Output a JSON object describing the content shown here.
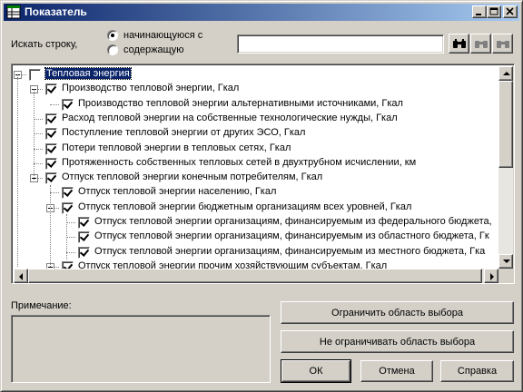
{
  "window": {
    "title": "Показатель",
    "controls": [
      "minimize-icon",
      "maximize-icon",
      "close-icon"
    ]
  },
  "search": {
    "label": "Искать строку,",
    "option_starts": "начинающуюся с",
    "option_contains": "содержащую",
    "selected": "starts",
    "value": ""
  },
  "tree": {
    "rows": [
      {
        "text": "Тепловая энергия",
        "checked": false,
        "level": 0,
        "expander": true,
        "selected": true
      },
      {
        "text": "Производство тепловой энергии,  Гкал",
        "checked": true,
        "level": 1,
        "expander": true
      },
      {
        "text": "Производство тепловой энергии альтернативными источниками, Гкал",
        "checked": true,
        "level": 2,
        "expander": false
      },
      {
        "text": "Расход тепловой энергии на собственные технологические нужды,  Гкал",
        "checked": true,
        "level": 1,
        "expander": false
      },
      {
        "text": "Поступление тепловой энергии от других ЭСО,  Гкал",
        "checked": true,
        "level": 1,
        "expander": false
      },
      {
        "text": "Потери тепловой энергии в тепловых сетях,  Гкал",
        "checked": true,
        "level": 1,
        "expander": false
      },
      {
        "text": "Протяженность собственных тепловых сетей в двухтрубном исчислении, км",
        "checked": true,
        "level": 1,
        "expander": false
      },
      {
        "text": "Отпуск тепловой энергии конечным потребителям,  Гкал",
        "checked": true,
        "level": 1,
        "expander": true
      },
      {
        "text": "Отпуск тепловой энергии населению,  Гкал",
        "checked": true,
        "level": 2,
        "expander": false
      },
      {
        "text": "Отпуск тепловой энергии бюджетным организациям всех уровней,   Гкал",
        "checked": true,
        "level": 2,
        "expander": true
      },
      {
        "text": "Отпуск тепловой энергии организациям, финансируемым из федерального бюджета,",
        "checked": true,
        "level": 3,
        "expander": false
      },
      {
        "text": "Отпуск тепловой энергии организациям, финансируемым из областного бюджета,  Гк",
        "checked": true,
        "level": 3,
        "expander": false
      },
      {
        "text": "Отпуск тепловой энергии организациям, финансируемым из местного бюджета,  Гка",
        "checked": true,
        "level": 3,
        "expander": false
      },
      {
        "text": "Отпуск тепловой энергии прочим хозяйствующим субъектам,  Гкал",
        "checked": true,
        "level": 2,
        "expander": true
      }
    ]
  },
  "note": {
    "label": "Примечание:"
  },
  "buttons": {
    "limit": "Ограничить область выбора",
    "no_limit": "Не ограничивать область выбора",
    "ok": "ОК",
    "cancel": "Отмена",
    "help": "Справка"
  },
  "icons": {
    "find": "binoculars-icon",
    "find_next": "binoculars-next-icon",
    "find_prev": "binoculars-prev-icon"
  }
}
